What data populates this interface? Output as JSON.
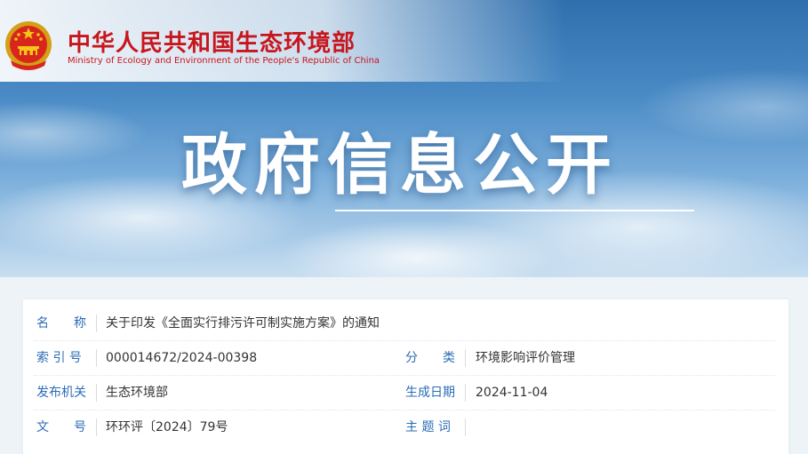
{
  "header": {
    "ministry_cn": "中华人民共和国生态环境部",
    "ministry_en": "Ministry of Ecology and Environment of the People's Republic of China",
    "emblem_icon": "national-emblem-icon",
    "banner_title": "政府信息公开",
    "brand_color": "#c8161d"
  },
  "info": {
    "label_color": "#2b6cb5",
    "rows": [
      {
        "label": "名　　称",
        "value": "关于印发《全面实行排污许可制实施方案》的通知"
      },
      {
        "label": "索 引 号",
        "value": "000014672/2024-00398",
        "label2": "分　　类",
        "value2": "环境影响评价管理"
      },
      {
        "label": "发布机关",
        "value": "生态环境部",
        "label2": "生成日期",
        "value2": "2024-11-04"
      },
      {
        "label": "文　　号",
        "value": "环环评〔2024〕79号",
        "label2": "主 题 词",
        "value2": ""
      }
    ]
  }
}
